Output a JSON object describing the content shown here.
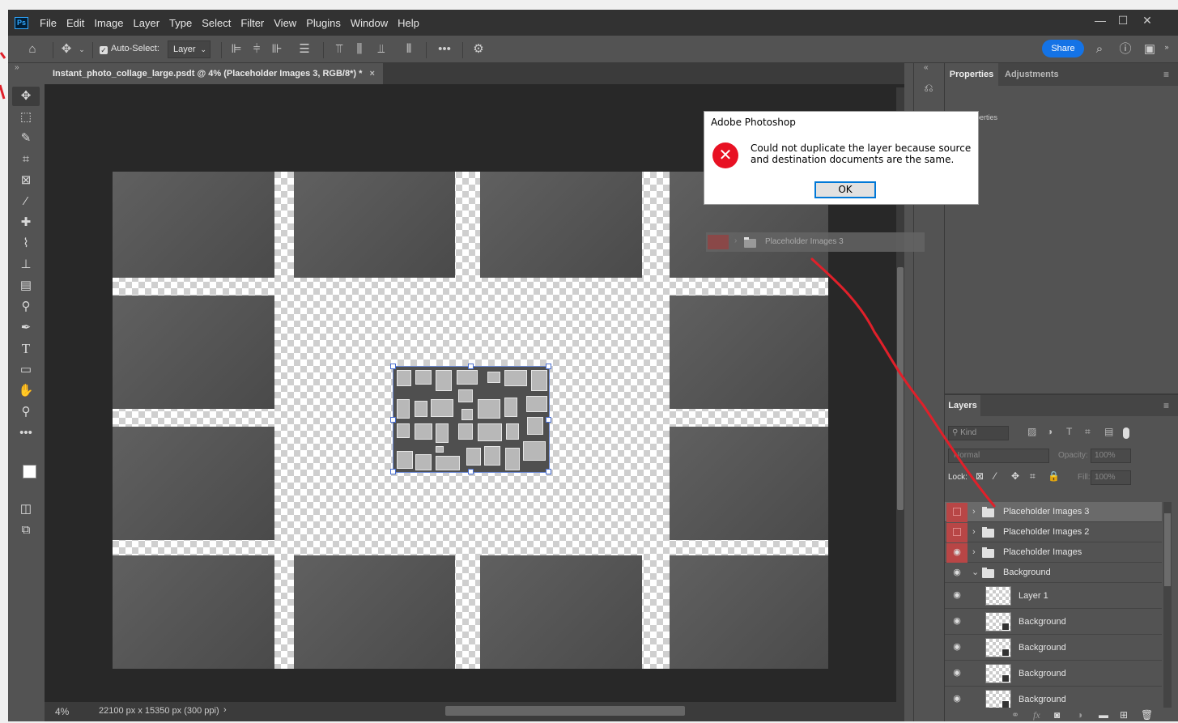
{
  "menu": {
    "logo": "Ps",
    "items": [
      "File",
      "Edit",
      "Image",
      "Layer",
      "Type",
      "Select",
      "Filter",
      "View",
      "Plugins",
      "Window",
      "Help"
    ]
  },
  "window_controls": {
    "minimize": "—",
    "maximize": "☐",
    "close": "✕"
  },
  "options": {
    "auto_select_label": "Auto-Select:",
    "auto_select_value": "Layer",
    "share_label": "Share"
  },
  "document": {
    "tab_title": "Instant_photo_collage_large.psdt @ 4% (Placeholder Images 3, RGB/8*) *",
    "close": "×"
  },
  "status": {
    "zoom": "4%",
    "dimensions": "22100 px x 15350 px (300 ppi)",
    "arrow": "›"
  },
  "properties_panel": {
    "tabs": [
      "Properties",
      "Adjustments"
    ],
    "content": "No Properties"
  },
  "layers_panel": {
    "title": "Layers",
    "kind_placeholder": "Kind",
    "blend_mode": "Normal",
    "opacity_label": "Opacity:",
    "opacity_value": "100%",
    "lock_label": "Lock:",
    "fill_label": "Fill:",
    "fill_value": "100%",
    "layers": [
      {
        "name": "Placeholder Images 3",
        "type": "group",
        "visible": false,
        "selected": true
      },
      {
        "name": "Placeholder Images 2",
        "type": "group",
        "visible": false
      },
      {
        "name": "Placeholder Images",
        "type": "group",
        "visible": true
      },
      {
        "name": "Background",
        "type": "group",
        "visible": true,
        "expanded": true
      },
      {
        "name": "Layer 1",
        "type": "layer",
        "visible": true
      },
      {
        "name": "Background",
        "type": "smart",
        "visible": true
      },
      {
        "name": "Background",
        "type": "smart",
        "visible": true
      },
      {
        "name": "Background",
        "type": "smart",
        "visible": true
      },
      {
        "name": "Background",
        "type": "smart",
        "visible": true
      }
    ]
  },
  "drag_ghost": {
    "label": "Placeholder Images 3"
  },
  "dialog": {
    "title": "Adobe Photoshop",
    "message": "Could not duplicate the layer because source and destination documents are the same.",
    "ok_label": "OK"
  },
  "colors": {
    "accent": "#1473e6",
    "panel": "#535353",
    "dark": "#323232",
    "error": "#e81123",
    "annotation": "#e0202a"
  }
}
